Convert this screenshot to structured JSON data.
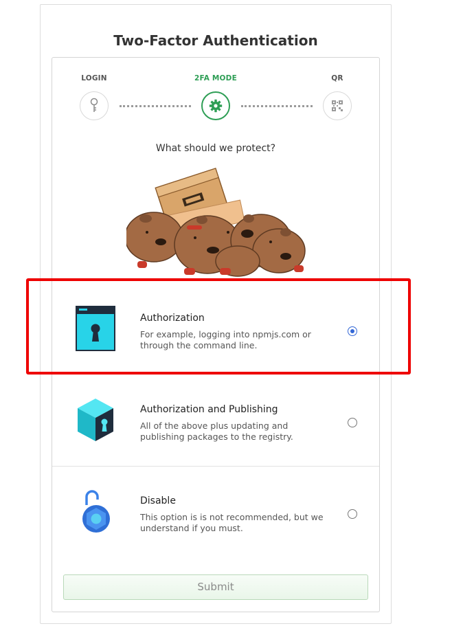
{
  "title": "Two-Factor Authentication",
  "stepper": {
    "steps": [
      {
        "label": "LOGIN",
        "icon": "key-icon",
        "active": false
      },
      {
        "label": "2FA MODE",
        "icon": "gear-icon",
        "active": true
      },
      {
        "label": "QR",
        "icon": "qr-icon",
        "active": false
      }
    ]
  },
  "prompt": "What should we protect?",
  "illustration": "wombats-with-npm-box",
  "options": [
    {
      "title": "Authorization",
      "description": "For example, logging into npmjs.com or through the command line.",
      "icon": "browser-keyhole-icon",
      "selected": true
    },
    {
      "title": "Authorization and Publishing",
      "description": "All of the above plus updating and publishing packages to the registry.",
      "icon": "cube-keyhole-icon",
      "selected": false
    },
    {
      "title": "Disable",
      "description": "This option is is not recommended, but we understand if you must.",
      "icon": "unlocked-padlock-icon",
      "selected": false
    }
  ],
  "submit_label": "Submit",
  "colors": {
    "accent_green": "#2e9e55",
    "radio_blue": "#3367d6",
    "highlight_red": "#ee0000"
  }
}
